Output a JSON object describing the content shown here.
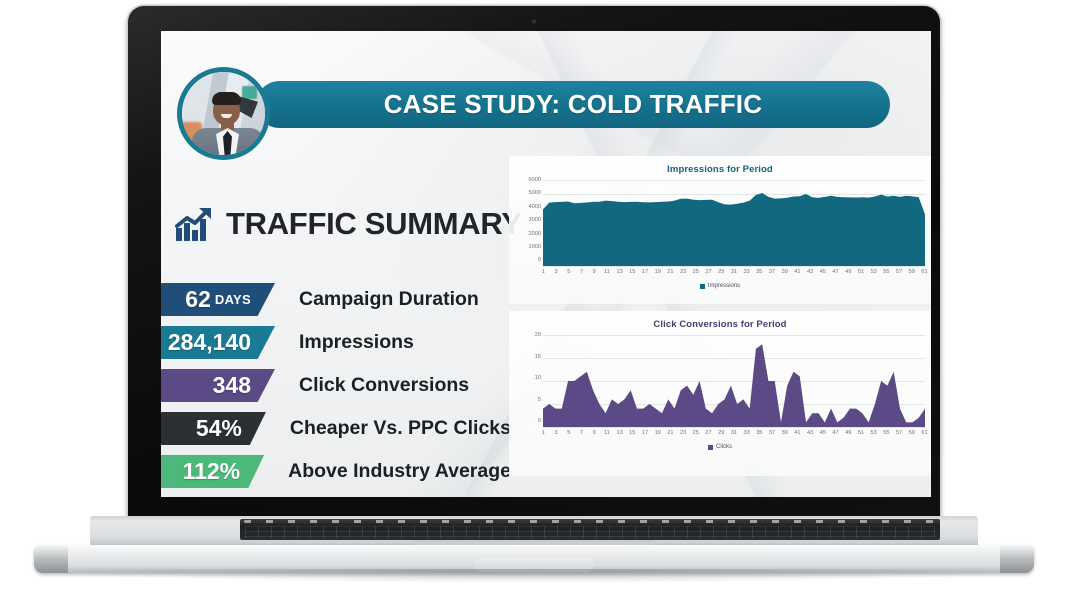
{
  "slide": {
    "title": "CASE STUDY: COLD TRAFFIC",
    "summary_heading": "TRAFFIC SUMMARY",
    "avatar_alt": "presenter-headshot",
    "colors": {
      "teal": "#15728c",
      "navy": "#1f4e79",
      "purple": "#5b4a86",
      "charcoal": "#2d3032",
      "green": "#4cb97a",
      "impressions_area": "#12697f",
      "clicks_area": "#5b4a86"
    }
  },
  "stats": [
    {
      "value": "62",
      "unit": "DAYS",
      "label": "Campaign Duration",
      "color": "#1f4e79"
    },
    {
      "value": "284,140",
      "unit": "",
      "label": "Impressions",
      "color": "#1a7a94"
    },
    {
      "value": "348",
      "unit": "",
      "label": "Click Conversions",
      "color": "#5b4a86"
    },
    {
      "value": "54%",
      "unit": "",
      "label": "Cheaper Vs. PPC Clicks",
      "color": "#2d3032"
    },
    {
      "value": "112%",
      "unit": "",
      "label": "Above Industry Average",
      "color": "#4cb97a"
    }
  ],
  "chart_data": [
    {
      "type": "area",
      "id": "impressions",
      "title": "Impressions for Period",
      "xlabel": "",
      "ylabel": "",
      "ylim": [
        0,
        6000
      ],
      "yticks": [
        6000,
        5000,
        4000,
        3000,
        2000,
        1000,
        0
      ],
      "grid": true,
      "legend": {
        "position": "bottom",
        "entries": [
          "Impressions"
        ]
      },
      "color": "#12697f",
      "x": [
        1,
        2,
        3,
        4,
        5,
        6,
        7,
        8,
        9,
        10,
        11,
        12,
        13,
        14,
        15,
        16,
        17,
        18,
        19,
        20,
        21,
        22,
        23,
        24,
        25,
        26,
        27,
        28,
        29,
        30,
        31,
        32,
        33,
        34,
        35,
        36,
        37,
        38,
        39,
        40,
        41,
        42,
        43,
        44,
        45,
        46,
        47,
        48,
        49,
        50,
        51,
        52,
        53,
        54,
        55,
        56,
        57,
        58,
        59,
        60,
        61,
        62
      ],
      "xticklabels": [
        1,
        3,
        5,
        7,
        9,
        11,
        13,
        15,
        17,
        19,
        21,
        23,
        25,
        27,
        29,
        31,
        33,
        35,
        37,
        39,
        41,
        43,
        45,
        47,
        49,
        51,
        53,
        55,
        57,
        59,
        61
      ],
      "series": [
        {
          "name": "Impressions",
          "values": [
            3950,
            4420,
            4460,
            4470,
            4500,
            4380,
            4400,
            4430,
            4470,
            4480,
            4560,
            4530,
            4480,
            4460,
            4470,
            4480,
            4450,
            4440,
            4460,
            4480,
            4500,
            4560,
            4690,
            4700,
            4620,
            4600,
            4610,
            4620,
            4450,
            4300,
            4280,
            4340,
            4420,
            4560,
            4950,
            5090,
            4820,
            4700,
            4720,
            4760,
            4850,
            4870,
            5020,
            4800,
            4750,
            4820,
            4900,
            4820,
            4800,
            4790,
            4780,
            4800,
            4770,
            4850,
            4980,
            4840,
            4900,
            4820,
            4900,
            4860,
            4800,
            3600
          ]
        }
      ]
    },
    {
      "type": "area",
      "id": "clicks",
      "title": "Click Conversions for Period",
      "xlabel": "",
      "ylabel": "",
      "ylim": [
        0,
        20
      ],
      "yticks": [
        20,
        15,
        10,
        5,
        0
      ],
      "grid": true,
      "legend": {
        "position": "bottom",
        "entries": [
          "Clicks"
        ]
      },
      "color": "#5b4a86",
      "x": [
        1,
        2,
        3,
        4,
        5,
        6,
        7,
        8,
        9,
        10,
        11,
        12,
        13,
        14,
        15,
        16,
        17,
        18,
        19,
        20,
        21,
        22,
        23,
        24,
        25,
        26,
        27,
        28,
        29,
        30,
        31,
        32,
        33,
        34,
        35,
        36,
        37,
        38,
        39,
        40,
        41,
        42,
        43,
        44,
        45,
        46,
        47,
        48,
        49,
        50,
        51,
        52,
        53,
        54,
        55,
        56,
        57,
        58,
        59,
        60,
        61,
        62
      ],
      "xticklabels": [
        1,
        3,
        5,
        7,
        9,
        11,
        13,
        15,
        17,
        19,
        21,
        23,
        25,
        27,
        29,
        31,
        33,
        35,
        37,
        39,
        41,
        43,
        45,
        47,
        49,
        51,
        53,
        55,
        57,
        59,
        61
      ],
      "series": [
        {
          "name": "Clicks",
          "values": [
            4,
            5,
            4,
            4,
            10,
            10,
            11,
            12,
            8,
            5,
            3,
            6,
            5,
            6,
            8,
            4,
            4,
            5,
            4,
            3,
            6,
            4,
            8,
            9,
            7,
            10,
            4,
            3,
            5,
            6,
            9,
            5,
            6,
            4,
            17,
            18,
            10,
            10,
            1,
            9,
            12,
            11,
            1,
            3,
            3,
            1,
            4,
            1,
            2,
            4,
            4,
            3,
            1,
            5,
            10,
            9,
            12,
            4,
            1,
            1,
            2,
            4
          ]
        }
      ]
    }
  ]
}
